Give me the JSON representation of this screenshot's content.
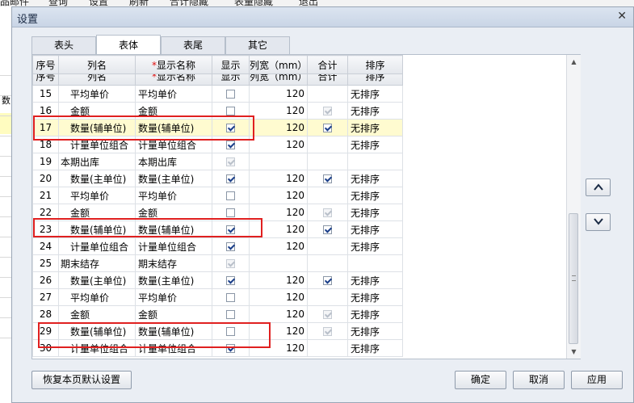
{
  "background": {
    "menu_items": [
      "品邮件",
      "查询",
      "设置",
      "刷新",
      "合计隐藏",
      "表量隐藏",
      "退出"
    ],
    "side_glyph": "数"
  },
  "dialog": {
    "title": "设置",
    "close_icon": "close-icon"
  },
  "tabs": [
    {
      "label": "表头",
      "active": false
    },
    {
      "label": "表体",
      "active": true
    },
    {
      "label": "表尾",
      "active": false
    },
    {
      "label": "其它",
      "active": false
    }
  ],
  "grid": {
    "columns": {
      "seq": "序号",
      "name": "列名",
      "required_mark": "*",
      "display": "显示名称",
      "show": "显示",
      "width": "列宽（mm）",
      "total": "合计",
      "sort": "排序"
    },
    "rows": [
      {
        "seq": "15",
        "name": "平均单价",
        "display": "平均单价",
        "show": false,
        "show_disabled": false,
        "width": "120",
        "total": false,
        "total_disabled": false,
        "total_visible": false,
        "sort": "无排序",
        "level": 1
      },
      {
        "seq": "16",
        "name": "金额",
        "display": "金额",
        "show": false,
        "show_disabled": false,
        "width": "120",
        "total": true,
        "total_disabled": true,
        "total_visible": true,
        "sort": "无排序",
        "level": 1
      },
      {
        "seq": "17",
        "name": "数量(辅单位)",
        "display": "数量(辅单位)",
        "show": true,
        "show_disabled": false,
        "width": "120",
        "total": true,
        "total_disabled": false,
        "total_visible": true,
        "sort": "无排序",
        "level": 1,
        "highlight": true
      },
      {
        "seq": "18",
        "name": "计量单位组合",
        "display": "计量单位组合",
        "show": true,
        "show_disabled": false,
        "width": "120",
        "total": false,
        "total_disabled": false,
        "total_visible": false,
        "sort": "无排序",
        "level": 1
      },
      {
        "seq": "19",
        "name": "本期出库",
        "display": "本期出库",
        "show": true,
        "show_disabled": true,
        "width": "",
        "total": false,
        "total_disabled": false,
        "total_visible": false,
        "sort": "",
        "level": 0
      },
      {
        "seq": "20",
        "name": "数量(主单位)",
        "display": "数量(主单位)",
        "show": true,
        "show_disabled": false,
        "width": "120",
        "total": true,
        "total_disabled": false,
        "total_visible": true,
        "sort": "无排序",
        "level": 1
      },
      {
        "seq": "21",
        "name": "平均单价",
        "display": "平均单价",
        "show": false,
        "show_disabled": false,
        "width": "120",
        "total": false,
        "total_disabled": false,
        "total_visible": false,
        "sort": "无排序",
        "level": 1
      },
      {
        "seq": "22",
        "name": "金额",
        "display": "金额",
        "show": false,
        "show_disabled": false,
        "width": "120",
        "total": true,
        "total_disabled": true,
        "total_visible": true,
        "sort": "无排序",
        "level": 1
      },
      {
        "seq": "23",
        "name": "数量(辅单位)",
        "display": "数量(辅单位)",
        "show": true,
        "show_disabled": false,
        "width": "120",
        "total": true,
        "total_disabled": false,
        "total_visible": true,
        "sort": "无排序",
        "level": 1
      },
      {
        "seq": "24",
        "name": "计量单位组合",
        "display": "计量单位组合",
        "show": true,
        "show_disabled": false,
        "width": "120",
        "total": false,
        "total_disabled": false,
        "total_visible": false,
        "sort": "无排序",
        "level": 1
      },
      {
        "seq": "25",
        "name": "期末结存",
        "display": "期末结存",
        "show": true,
        "show_disabled": true,
        "width": "",
        "total": false,
        "total_disabled": false,
        "total_visible": false,
        "sort": "",
        "level": 0
      },
      {
        "seq": "26",
        "name": "数量(主单位)",
        "display": "数量(主单位)",
        "show": true,
        "show_disabled": false,
        "width": "120",
        "total": true,
        "total_disabled": false,
        "total_visible": true,
        "sort": "无排序",
        "level": 1
      },
      {
        "seq": "27",
        "name": "平均单价",
        "display": "平均单价",
        "show": false,
        "show_disabled": false,
        "width": "120",
        "total": false,
        "total_disabled": false,
        "total_visible": false,
        "sort": "无排序",
        "level": 1
      },
      {
        "seq": "28",
        "name": "金额",
        "display": "金额",
        "show": false,
        "show_disabled": false,
        "width": "120",
        "total": true,
        "total_disabled": true,
        "total_visible": true,
        "sort": "无排序",
        "level": 1
      },
      {
        "seq": "29",
        "name": "数量(辅单位)",
        "display": "数量(辅单位)",
        "show": false,
        "show_disabled": false,
        "width": "120",
        "total": true,
        "total_disabled": true,
        "total_visible": true,
        "sort": "无排序",
        "level": 1
      },
      {
        "seq": "30",
        "name": "计量单位组合",
        "display": "计量单位组合",
        "show": true,
        "show_disabled": false,
        "width": "120",
        "total": false,
        "total_disabled": false,
        "total_visible": false,
        "sort": "无排序",
        "level": 1
      }
    ]
  },
  "side_buttons": {
    "up_icon": "chevron-up-icon",
    "down_icon": "chevron-down-icon"
  },
  "footer": {
    "restore_label": "恢复本页默认设置",
    "ok_label": "确定",
    "cancel_label": "取消",
    "apply_label": "应用"
  },
  "colors": {
    "highlight_row": "#fffbd0",
    "annotation_box": "#e02020",
    "required_mark": "#e01010"
  }
}
